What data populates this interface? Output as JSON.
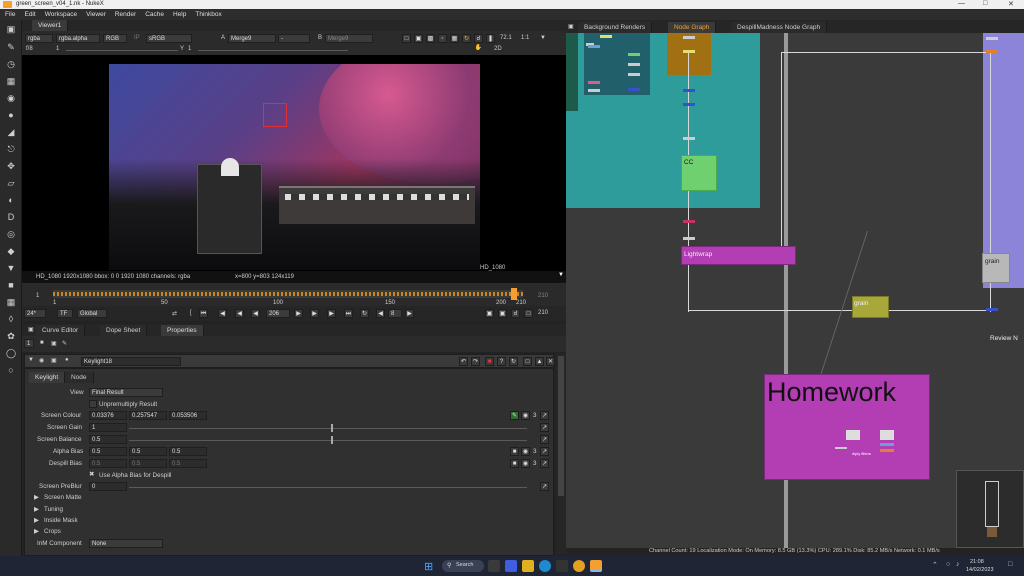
{
  "window": {
    "title": "green_screen_v04_1.nk - NukeX"
  },
  "menu": [
    "File",
    "Edit",
    "Workspace",
    "Viewer",
    "Render",
    "Cache",
    "Help",
    "Thinkbox"
  ],
  "viewer": {
    "tab": "Viewer1",
    "channels": "rgba",
    "layer": "rgba.alpha",
    "colorspace": "RGB",
    "space_off": "sRGB",
    "input_a": "Merge9",
    "dash": "-",
    "input_b": "Merge9",
    "zoom": "72.1",
    "ratio": "1:1",
    "mode": "2D",
    "frame_label": "f/8",
    "frame_val": "1",
    "y_label": "Y",
    "y_val": "1",
    "format_label": "HD_1080",
    "format_label_br": "HD_1080",
    "info": "HD_1080 1920x1080  bbox: 0 0 1920 1080 channels: rgba",
    "coords": "x=800 y=803 124x119"
  },
  "timeline": {
    "start": "1",
    "end": "210",
    "end_right": "210",
    "ticks": [
      "1",
      "50",
      "100",
      "150",
      "200",
      "210"
    ],
    "current": "206",
    "fps": "24*",
    "tf": "TF",
    "scope": "Global",
    "step": "8",
    "end2": "210"
  },
  "panels": {
    "tabs": [
      "Curve Editor",
      "Dope Sheet",
      "Properties"
    ],
    "num": "1"
  },
  "props": {
    "node_name": "Keylight18",
    "tabs": [
      "Keylight",
      "Node"
    ],
    "view_label": "View",
    "view_val": "Final Result",
    "unpremult": "Unpremultiply Result",
    "screen_colour_label": "Screen Colour",
    "sc": [
      "0.03376",
      "0.257547",
      "0.053506"
    ],
    "sc_num": "3",
    "screen_gain_label": "Screen Gain",
    "screen_gain": "1",
    "screen_balance_label": "Screen Balance",
    "screen_balance": "0.5",
    "alpha_bias_label": "Alpha Bias",
    "ab": [
      "0.5",
      "0.5",
      "0.5"
    ],
    "ab_num": "3",
    "despill_bias_label": "Despill Bias",
    "db": [
      "0.5",
      "0.5",
      "0.5"
    ],
    "db_num": "3",
    "use_alpha": "Use Alpha Bias for Despill",
    "preblur_label": "Screen PreBlur",
    "preblur": "0",
    "groups": [
      "Screen Matte",
      "Tuning",
      "Inside Mask",
      "Crops"
    ],
    "inm_label": "InM Component",
    "inm_val": "None",
    "gain_ticks": [
      "0",
      "0.1",
      "0.2",
      "0.3",
      "0.4",
      "0.5",
      "0.6",
      "0.7",
      "0.8",
      "0.9",
      "1",
      "1.1",
      "1.2",
      "1.3",
      "1.4",
      "1.5",
      "1.6",
      "1.7",
      "1.8",
      "1.9",
      "2"
    ],
    "blur_ticks": [
      "0",
      "10",
      "20",
      "30",
      "40",
      "50",
      "60",
      "70",
      "80",
      "90",
      "100"
    ]
  },
  "nodegraph": {
    "tabs": [
      "Background Renders",
      "Node Graph",
      "DespillMadness Node Graph"
    ],
    "nodes": {
      "cc": "CC",
      "lightwrap": "Lightwrap",
      "grain": "grain",
      "grain2": "grain",
      "review": "Review N",
      "homework": "Homework",
      "inner": "diply filters"
    }
  },
  "status": "Channel Count: 19 Localization Mode: On Memory: 8.5 GB (13.3%) CPU: 289.1% Disk: 85.2 MB/s Network: 0.1 MB/s",
  "taskbar": {
    "search": "Search",
    "time": "21:08",
    "date": "14/02/2023"
  },
  "colors": {
    "accent": "#f3a030",
    "teal": "#2f9c9c",
    "magenta": "#b33db3",
    "green": "#6fd06f",
    "olive": "#a8a83a",
    "purple": "#8c84d8"
  }
}
